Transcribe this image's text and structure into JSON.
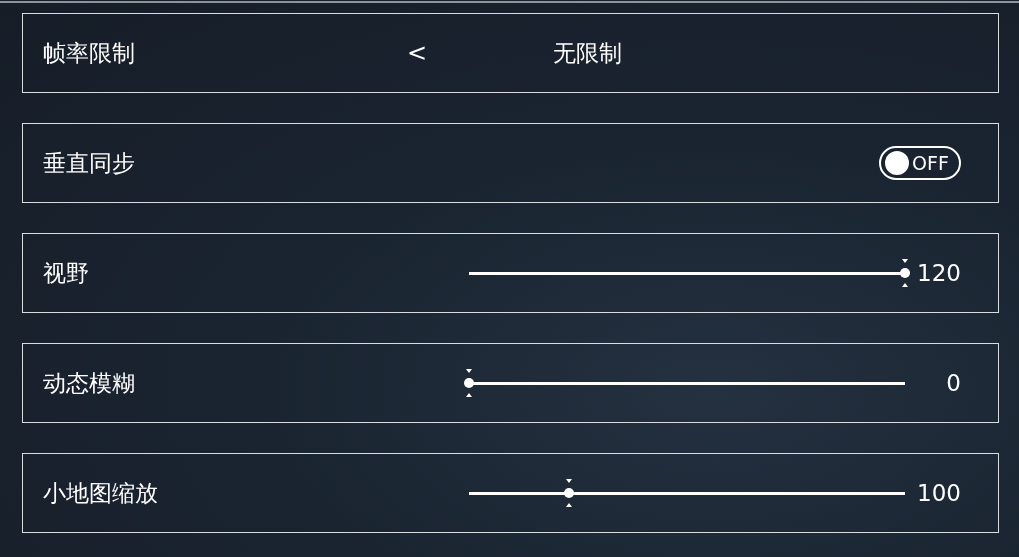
{
  "settings": [
    {
      "kind": "selector",
      "label": "帧率限制",
      "value": "无限制",
      "prev": "<"
    },
    {
      "kind": "toggle",
      "label": "垂直同步",
      "on": false,
      "state_text": "OFF"
    },
    {
      "kind": "slider",
      "label": "视野",
      "level": 1.0,
      "reading": "120"
    },
    {
      "kind": "slider",
      "label": "动态模糊",
      "level": 0,
      "reading": "0"
    },
    {
      "kind": "slider",
      "label": "小地图缩放",
      "level": 0.23,
      "reading": "100"
    }
  ]
}
